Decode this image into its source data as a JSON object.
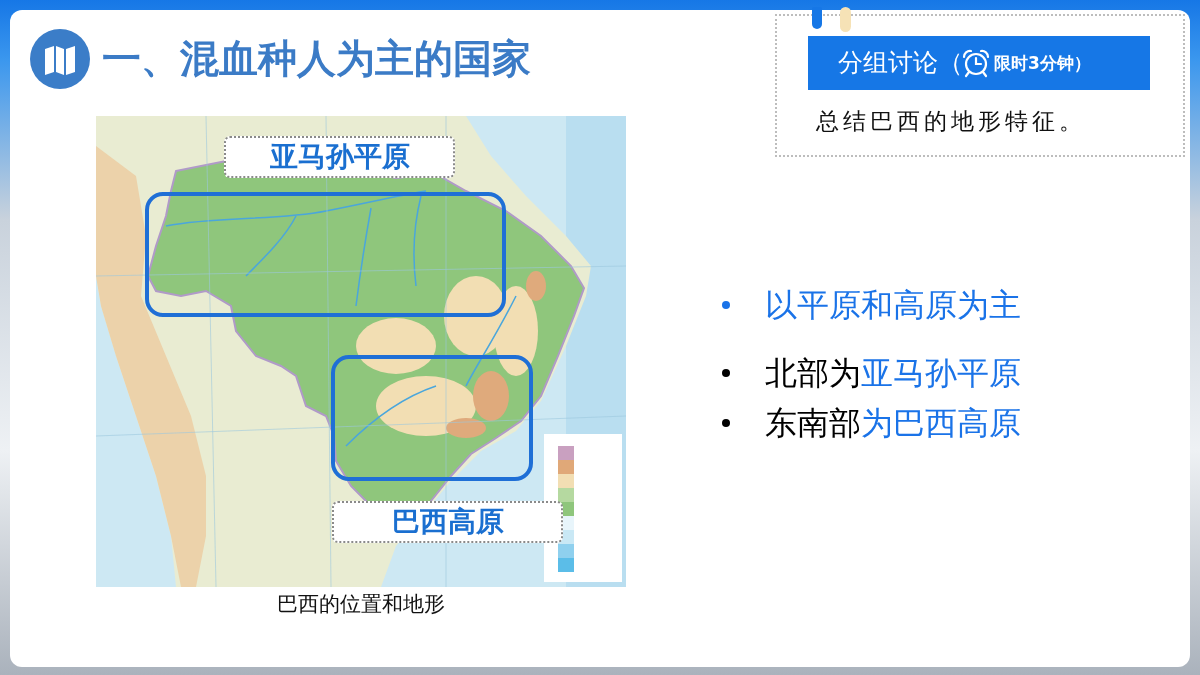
{
  "header": {
    "title": "一、混血种人为主的国家"
  },
  "map": {
    "labels": [
      {
        "text": "亚马孙平原"
      },
      {
        "text": "巴西高原"
      }
    ],
    "caption": "巴西的位置和地形"
  },
  "discussion": {
    "title": "分组讨论（",
    "timer": "限时3分钟）",
    "task": "总结巴西的地形特征。"
  },
  "bullets": [
    {
      "color": "#1a73e8",
      "segments": [
        {
          "text": "以平原和高原为主",
          "highlight": true
        }
      ]
    },
    {
      "color": "#000000",
      "segments": [
        {
          "text": "北部为",
          "highlight": false
        },
        {
          "text": "亚马孙平原",
          "highlight": true
        }
      ]
    },
    {
      "color": "#000000",
      "segments": [
        {
          "text": "东南部",
          "highlight": false
        },
        {
          "text": "为巴西高原",
          "highlight": true
        }
      ]
    }
  ]
}
